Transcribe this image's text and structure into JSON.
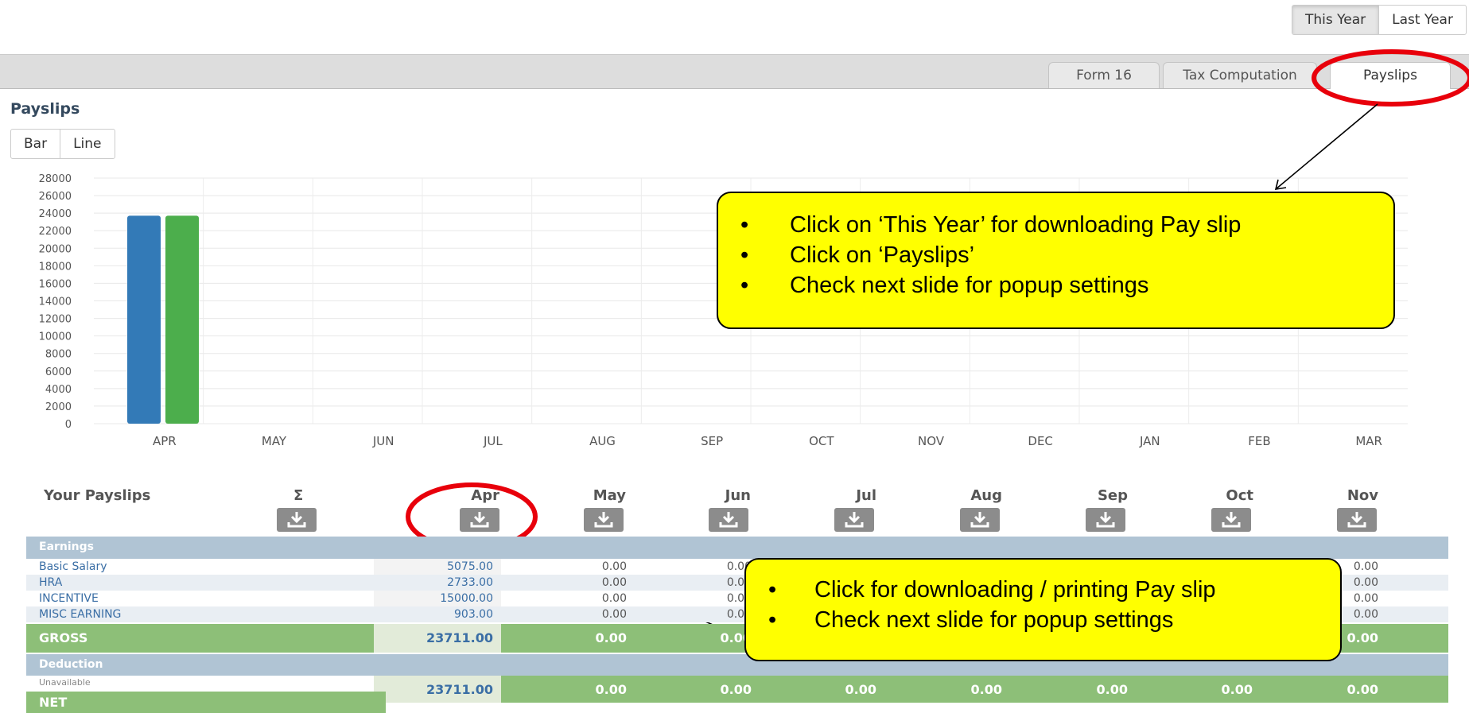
{
  "year_toggle": {
    "this_year": "This Year",
    "last_year": "Last Year"
  },
  "tabs": [
    "Form 16",
    "Tax Computation",
    "Payslips"
  ],
  "section_title": "Payslips",
  "chart_type_toggle": {
    "bar": "Bar",
    "line": "Line"
  },
  "chart_data": {
    "type": "bar",
    "categories": [
      "APR",
      "MAY",
      "JUN",
      "JUL",
      "AUG",
      "SEP",
      "OCT",
      "NOV",
      "DEC",
      "JAN",
      "FEB",
      "MAR"
    ],
    "series": [
      {
        "values": [
          23711,
          0,
          0,
          0,
          0,
          0,
          0,
          0,
          0,
          0,
          0,
          0
        ],
        "color": "#337ab7"
      },
      {
        "values": [
          23711,
          0,
          0,
          0,
          0,
          0,
          0,
          0,
          0,
          0,
          0,
          0
        ],
        "color": "#4cae4c"
      }
    ],
    "ylim": [
      0,
      28000
    ],
    "yticks": [
      "0",
      "2000",
      "4000",
      "6000",
      "8000",
      "10000",
      "12000",
      "14000",
      "16000",
      "18000",
      "20000",
      "22000",
      "24000",
      "26000",
      "28000"
    ],
    "grid": true
  },
  "callout_top": {
    "items": [
      "Click on ‘This Year’ for downloading Pay slip",
      "Click on ‘Payslips’",
      "Check next slide for popup  settings"
    ]
  },
  "callout_bottom": {
    "items": [
      "Click for downloading / printing Pay slip",
      "Check next slide for popup  settings"
    ]
  },
  "payslips_table": {
    "title": "Your Payslips",
    "sigma": "Σ",
    "months": [
      "Apr",
      "May",
      "Jun",
      "Jul",
      "Aug",
      "Sep",
      "Oct",
      "Nov"
    ],
    "earnings_label": "Earnings",
    "rows": [
      {
        "label": "Basic Salary",
        "apr": "5075.00",
        "may": "0.00",
        "jun": "0.00",
        "nov": "0.00"
      },
      {
        "label": "HRA",
        "apr": "2733.00",
        "may": "0.00",
        "jun": "0.00",
        "nov": "0.00"
      },
      {
        "label": "INCENTIVE",
        "apr": "15000.00",
        "may": "0.00",
        "jun": "0.00",
        "nov": "0.00"
      },
      {
        "label": "MISC EARNING",
        "apr": "903.00",
        "may": "0.00",
        "jun": "0.00",
        "nov": "0.00"
      }
    ],
    "gross_label": "GROSS",
    "gross_values": [
      "23711.00",
      "0.00",
      "0.00",
      "0.00"
    ],
    "deduction_label": "Deduction",
    "unavailable": "Unavailable",
    "net_label": "NET",
    "net_values": [
      "23711.00",
      "0.00",
      "0.00",
      "0.00",
      "0.00",
      "0.00",
      "0.00",
      "0.00"
    ],
    "colors": {
      "band": "#b0c4d4",
      "green": "#8dbf78",
      "highlight": "#e2ebd9"
    }
  }
}
